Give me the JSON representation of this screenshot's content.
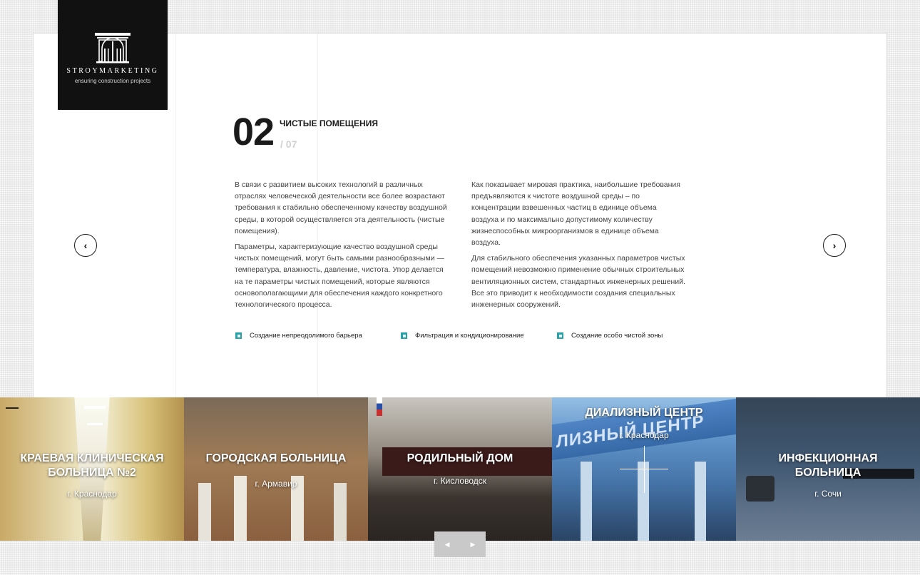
{
  "brand": {
    "name": "STROYMARKETING",
    "tagline": "ensuring construction projects",
    "logo_icon": "arch-building-icon"
  },
  "slide": {
    "number": "02",
    "title": "ЧИСТЫЕ ПОМЕЩЕНИЯ",
    "total": "/ 07",
    "col1": [
      "В связи с развитием высоких технологий в различных отраслях человеческой деятельности все более возрастают требования к стабильно обеспеченному качеству воздушной среды, в которой осуществляется эта деятельность (чистые помещения).",
      "Параметры, характеризующие качество воздушной среды чистых помещений, могут быть самыми разнообразными — температура, влажность, давление, чистота. Упор делается на те параметры чистых помещений, которые являются основополагающими для обеспечения каждого конкретного технологического процесса."
    ],
    "col2": [
      "Как показывает мировая практика, наибольшие требования предъявляются к чистоте воздушной среды – по концентрации взвешенных частиц в единице объема воздуха и по максимально допустимому количеству жизнеспособных микроорганизмов в единице объема воздуха.",
      "Для стабильного обеспечения указанных параметров чистых помещений невозможно применение обычных строительных вентиляционных систем, стандартных инженерных решений. Все это приводит к необходимости создания специальных инженерных сооружений."
    ],
    "features": [
      "Создание непреодолимого барьера",
      "Фильтрация и кондиционирование",
      "Создание особо чистой зоны"
    ]
  },
  "nav": {
    "prev_icon": "chevron-left-icon",
    "next_icon": "chevron-right-icon",
    "prev_glyph": "‹",
    "next_glyph": "›"
  },
  "projects": [
    {
      "title": "КРАЕВАЯ КЛИНИЧЕСКАЯ БОЛЬНИЦА №2",
      "city": "г. Краснодар",
      "bg": "#b89c5e"
    },
    {
      "title": "ГОРОДСКАЯ БОЛЬНИЦА",
      "city": "г. Армавир",
      "bg": "#8c6e4c"
    },
    {
      "title": "РОДИЛЬНЫЙ ДОМ",
      "city": "г. Кисловодск",
      "bg": "#4d4640"
    },
    {
      "title": "ДИАЛИЗНЫЙ ЦЕНТР",
      "city": "г. Краснодар",
      "bg": "#3f6fa8",
      "sign": "ЛИЗНЫЙ ЦЕНТР"
    },
    {
      "title": "ИНФЕКЦИОННАЯ БОЛЬНИЦА",
      "city": "г. Сочи",
      "bg": "#3c4b5a"
    }
  ],
  "pager": {
    "prev": "◀",
    "next": "▶"
  },
  "colors": {
    "accent": "#2aa0a8",
    "dark": "#111111"
  }
}
